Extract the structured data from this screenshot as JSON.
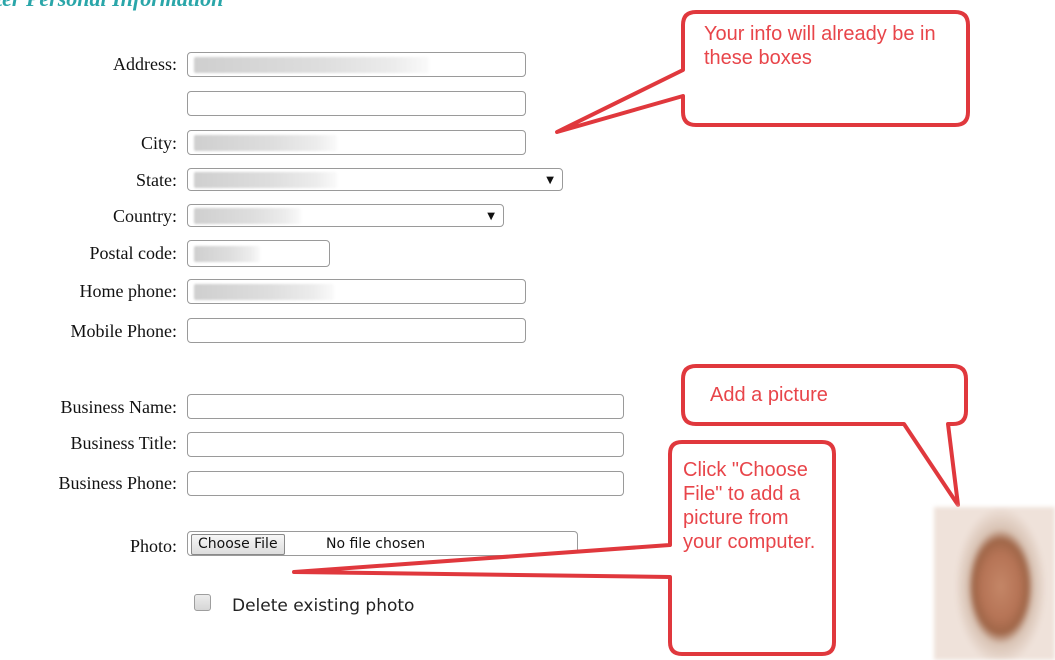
{
  "section_title": "ter Personal Information",
  "form": {
    "address_label": "Address:",
    "city_label": "City:",
    "state_label": "State:",
    "country_label": "Country:",
    "postal_label": "Postal code:",
    "home_phone_label": "Home phone:",
    "mobile_phone_label": "Mobile Phone:",
    "business_name_label": "Business Name:",
    "business_title_label": "Business Title:",
    "business_phone_label": "Business Phone:",
    "photo_label": "Photo:",
    "choose_file_label": "Choose File",
    "no_file_text": "No file chosen",
    "delete_photo_label": "Delete existing photo"
  },
  "callouts": {
    "info": "Your info will already be in these boxes",
    "add_picture": "Add a picture",
    "choose_file_help": "Click \"Choose File\" to add a picture from your computer."
  },
  "colors": {
    "title": "#2aa6a9",
    "callout_border": "#e0383d",
    "callout_text": "#e8454a"
  },
  "icons": {
    "select_caret": "▼"
  }
}
